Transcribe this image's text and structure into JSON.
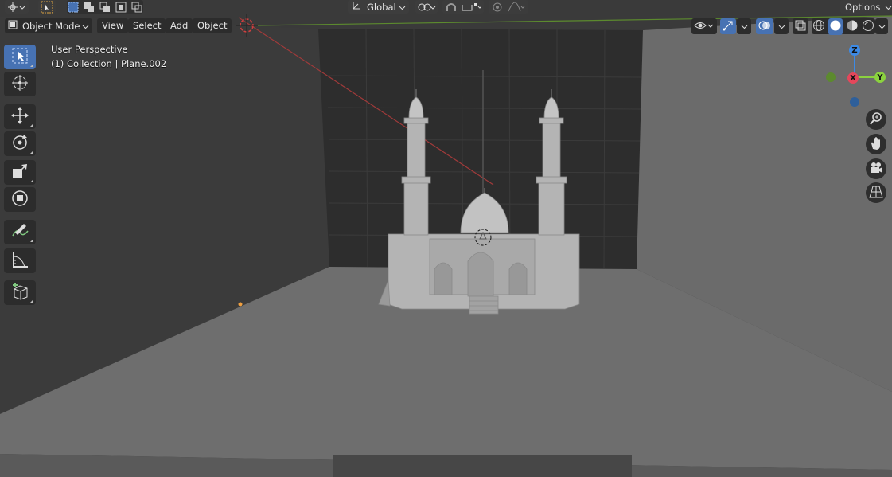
{
  "header": {
    "transform_orientation": "Global",
    "options_label": "Options"
  },
  "viewport_header": {
    "mode": "Object Mode",
    "menus": [
      "View",
      "Select",
      "Add",
      "Object"
    ]
  },
  "overlay": {
    "perspective": "User Perspective",
    "collection": "(1) Collection | Plane.002"
  },
  "gizmo": {
    "axes": [
      "X",
      "Y",
      "Z"
    ],
    "colors": {
      "x": "#e4475b",
      "y": "#8bd23f",
      "z": "#3d8ae5"
    }
  },
  "tools": [
    "tweak-select",
    "cursor",
    "move",
    "rotate",
    "scale",
    "transform",
    "annotate",
    "measure",
    "add-cube"
  ],
  "colors": {
    "accent": "#4772b3",
    "floor": "#6e6e6e",
    "background": "#303030"
  }
}
